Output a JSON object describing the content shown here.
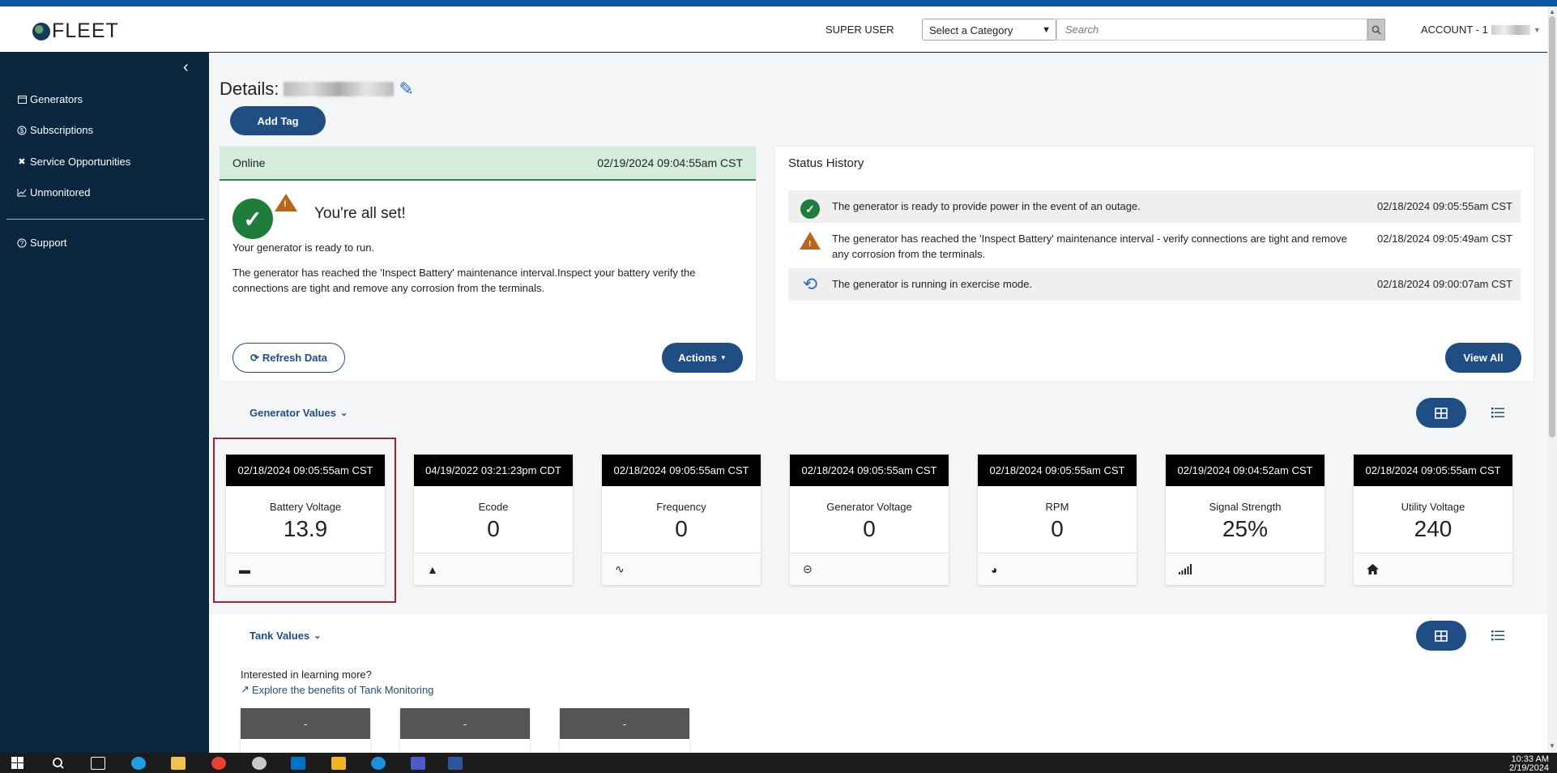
{
  "header": {
    "logo_text": "FLEET",
    "user_role": "SUPER USER",
    "category_select": "Select a Category",
    "search_placeholder": "Search",
    "account_label": "ACCOUNT - 1"
  },
  "sidebar": {
    "items": [
      {
        "label": "Generators",
        "icon": "generator-icon"
      },
      {
        "label": "Subscriptions",
        "icon": "dollar-icon"
      },
      {
        "label": "Service Opportunities",
        "icon": "tools-icon"
      },
      {
        "label": "Unmonitored",
        "icon": "chart-line-icon"
      },
      {
        "label": "Support",
        "icon": "question-icon"
      }
    ]
  },
  "details": {
    "title_prefix": "Details:",
    "add_tag_label": "Add Tag"
  },
  "status_card": {
    "status": "Online",
    "timestamp": "02/19/2024 09:04:55am CST",
    "headline": "You're all set!",
    "ready_text": "Your generator is ready to run.",
    "message": "The generator has reached the 'Inspect Battery' maintenance interval.Inspect your battery verify the connections are tight and remove any corrosion from the terminals.",
    "refresh_label": "Refresh Data",
    "actions_label": "Actions"
  },
  "status_history": {
    "title": "Status History",
    "rows": [
      {
        "icon": "check-circle-icon",
        "text": "The generator is ready to provide power in the event of an outage.",
        "time": "02/18/2024 09:05:55am CST"
      },
      {
        "icon": "warning-icon",
        "text": "The generator has reached the 'Inspect Battery' maintenance interval - verify connections are tight and remove any corrosion from the terminals.",
        "time": "02/18/2024 09:05:49am CST"
      },
      {
        "icon": "exercise-icon",
        "text": "The generator is running in exercise mode.",
        "time": "02/18/2024 09:00:07am CST"
      }
    ],
    "view_all_label": "View All"
  },
  "generator_values": {
    "title": "Generator Values",
    "tiles": [
      {
        "time": "02/18/2024 09:05:55am CST",
        "label": "Battery Voltage",
        "value": "13.9",
        "icon": "battery-icon"
      },
      {
        "time": "04/19/2022 03:21:23pm CDT",
        "label": "Ecode",
        "value": "0",
        "icon": "bell-icon"
      },
      {
        "time": "02/18/2024 09:05:55am CST",
        "label": "Frequency",
        "value": "0",
        "icon": "wave-icon"
      },
      {
        "time": "02/18/2024 09:05:55am CST",
        "label": "Generator Voltage",
        "value": "0",
        "icon": "generator-voltage-icon"
      },
      {
        "time": "02/18/2024 09:05:55am CST",
        "label": "RPM",
        "value": "0",
        "icon": "gauge-icon"
      },
      {
        "time": "02/19/2024 09:04:52am CST",
        "label": "Signal Strength",
        "value": "25%",
        "icon": "signal-icon"
      },
      {
        "time": "02/18/2024 09:05:55am CST",
        "label": "Utility Voltage",
        "value": "240",
        "icon": "home-icon"
      }
    ]
  },
  "tank_values": {
    "title": "Tank Values",
    "interested_text": "Interested in learning more?",
    "explore_link": "Explore the benefits of Tank Monitoring",
    "tiles": [
      "-",
      "-",
      "-"
    ]
  },
  "taskbar": {
    "time": "10:33 AM",
    "date": "2/19/2024"
  },
  "colors": {
    "sidebar_bg": "#0b2740",
    "primary": "#1f4e84",
    "online_bg": "#d4ecdc",
    "success": "#1e7d3b",
    "warning": "#b8661a",
    "highlight": "#a3232b"
  }
}
